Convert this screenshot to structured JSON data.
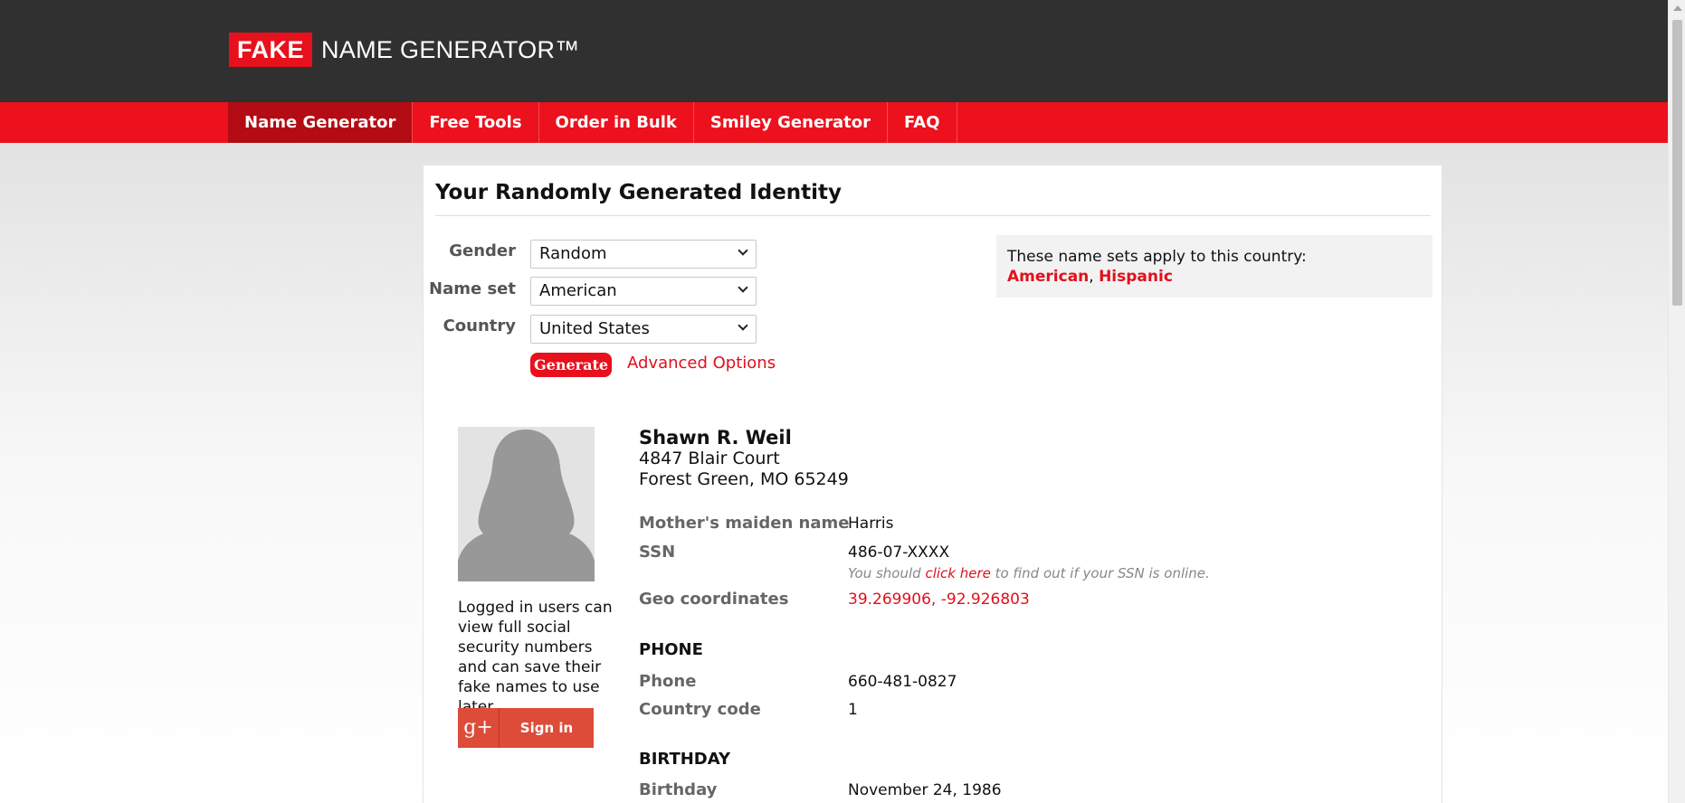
{
  "header": {
    "logo_fake": "FAKE",
    "logo_rest": "NAME GENERATOR™"
  },
  "nav": {
    "items": [
      "Name Generator",
      "Free Tools",
      "Order in Bulk",
      "Smiley Generator",
      "FAQ"
    ],
    "active": "Name Generator"
  },
  "page": {
    "title": "Your Randomly Generated Identity"
  },
  "form": {
    "gender_label": "Gender",
    "gender_value": "Random",
    "nameset_label": "Name set",
    "nameset_value": "American",
    "country_label": "Country",
    "country_value": "United States",
    "generate_label": "Generate",
    "advanced_label": "Advanced Options"
  },
  "info": {
    "text": "These name sets apply to this country:",
    "link1": "American",
    "separator": ",",
    "link2": "Hispanic"
  },
  "identity": {
    "name": "Shawn R. Weil",
    "address_line1": "4847 Blair Court",
    "address_line2": "Forest Green, MO 65249",
    "maiden_label": "Mother's maiden name",
    "maiden_value": "Harris",
    "ssn_label": "SSN",
    "ssn_value": "486-07-XXXX",
    "ssn_note_pre": "You should",
    "ssn_note_link": "click here",
    "ssn_note_post": "to find out if your SSN is online.",
    "geo_label": "Geo coordinates",
    "geo_value": "39.269906, -92.926803",
    "phone_section": "PHONE",
    "phone_label": "Phone",
    "phone_value": "660-481-0827",
    "cc_label": "Country code",
    "cc_value": "1",
    "birthday_section": "BIRTHDAY",
    "birthday_label": "Birthday",
    "birthday_value": "November 24, 1986"
  },
  "sidebar": {
    "login_text": "Logged in users can view full social security numbers and can save their fake names to use later.",
    "gplus_icon": "g+",
    "signin_label": "Sign in"
  },
  "colors": {
    "brand_red": "#ec111c",
    "dark_header": "#303030",
    "active_nav": "#b30c14"
  }
}
